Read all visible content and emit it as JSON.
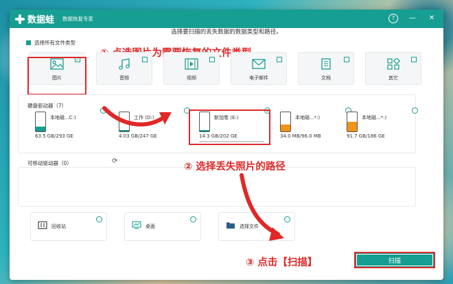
{
  "app": {
    "logo_text": "数据蛙",
    "subtitle": "数据恢复专家"
  },
  "instruction": "选择要扫描的丢失数据的数据类型和路径。",
  "select_all_label": "选择所有文件类型",
  "file_types": [
    {
      "label": "图片",
      "icon": "image-icon",
      "checked": true
    },
    {
      "label": "音频",
      "icon": "audio-icon",
      "checked": false
    },
    {
      "label": "视频",
      "icon": "video-icon",
      "checked": false
    },
    {
      "label": "电子邮件",
      "icon": "email-icon",
      "checked": false
    },
    {
      "label": "文档",
      "icon": "document-icon",
      "checked": false
    },
    {
      "label": "其它",
      "icon": "other-icon",
      "checked": false
    }
  ],
  "hard_drives": {
    "title": "硬盘驱动器（7）",
    "items": [
      {
        "name": "本地磁...C:)",
        "size": "63.5 GB/293 GE",
        "selected": false
      },
      {
        "name": "工作 (D:)",
        "size": "4.03 GB/247 GE",
        "selected": false
      },
      {
        "name": "新加卷 (E:)",
        "size": "14.3 GB/202 GE",
        "selected": true
      },
      {
        "name": "本地磁...*:)",
        "size": "34.0 MB/96.0 MB",
        "selected": false
      },
      {
        "name": "本地磁...*:)",
        "size": "91.7 GB/186 GE",
        "selected": false
      }
    ]
  },
  "removable": {
    "title": "可移动驱动器（0）"
  },
  "locations": [
    {
      "label": "回收站",
      "icon": "recycle-bin-icon"
    },
    {
      "label": "桌面",
      "icon": "desktop-icon"
    },
    {
      "label": "选择文件",
      "icon": "folder-icon"
    }
  ],
  "annotations": {
    "step1": "① 点选图片为需要恢复的文件类型",
    "step2": "② 选择丢失照片的路径",
    "step3": "③ 点击【扫描】"
  },
  "scan_button": "扫描",
  "colors": {
    "accent": "#179e92",
    "annotation_red": "#e02828"
  }
}
